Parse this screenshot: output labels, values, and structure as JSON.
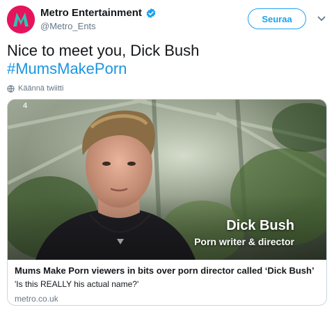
{
  "account": {
    "name": "Metro Entertainment",
    "handle": "@Metro_Ents",
    "verified_icon": "verified-badge-icon",
    "avatar_colors": {
      "background": "#e5145c",
      "accent": "#2ec4b6"
    }
  },
  "actions": {
    "follow_label": "Seuraa",
    "menu_icon": "chevron-down-icon"
  },
  "tweet": {
    "text": "Nice to meet you, Dick Bush",
    "hashtag": "#MumsMakePorn",
    "translate_label": "Käännä twiitti",
    "translate_icon": "globe-icon"
  },
  "card": {
    "overlay_name": "Dick Bush",
    "overlay_role": "Porn writer & director",
    "title": "Mums Make Porn viewers in bits over porn director called ‘Dick Bush’",
    "description": "'Is this REALLY his actual name?'",
    "domain": "metro.co.uk"
  },
  "colors": {
    "link": "#1b95e0",
    "follow_border": "#1da1f2",
    "muted": "#657786"
  }
}
